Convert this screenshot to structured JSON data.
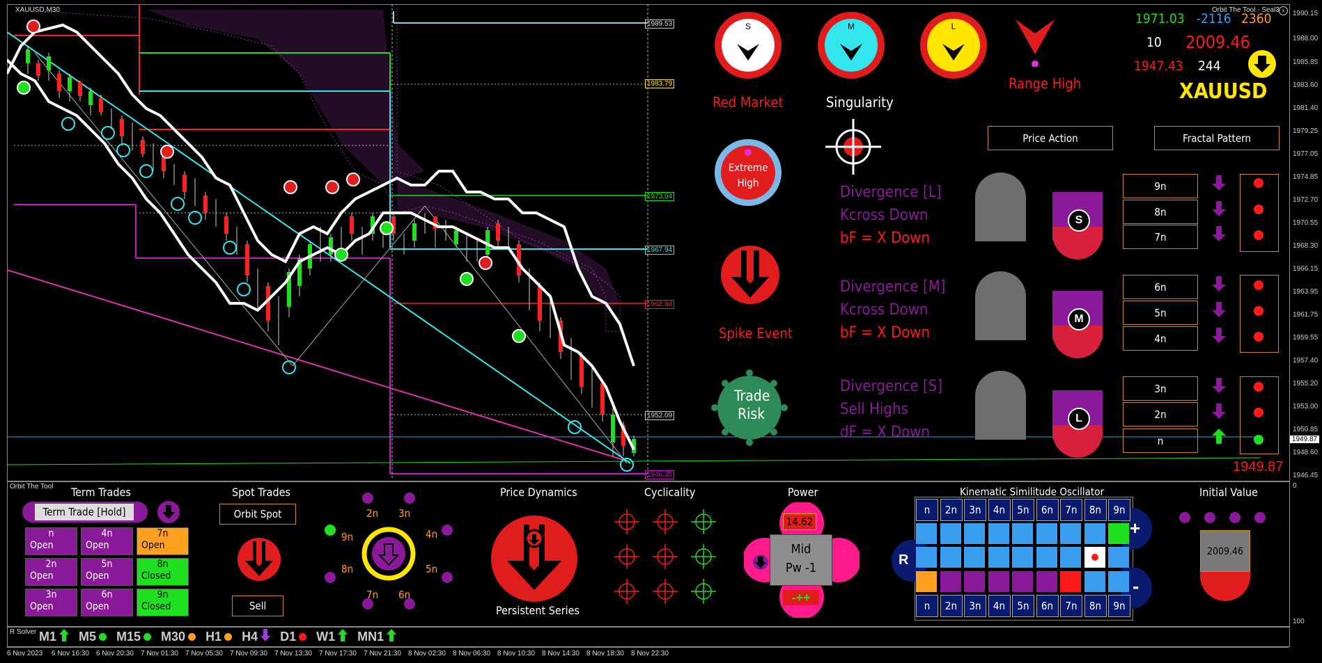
{
  "window": {
    "symbol_title": "XAUUSD,M30",
    "top_right_label": "Orbit The Tool - Seal3"
  },
  "price_axis": {
    "labels": [
      "1990.15",
      "1988.00",
      "1985.85",
      "1983.60",
      "1981.40",
      "1979.25",
      "1977.05",
      "1974.85",
      "1972.70",
      "1970.55",
      "1968.30",
      "1966.15",
      "1963.95",
      "1961.75",
      "1959.55",
      "1957.40",
      "1955.20",
      "1953.00",
      "1950.85",
      "1949.87",
      "1948.60",
      "1946.45"
    ],
    "current_price": "1949.87",
    "sub_labels": [
      "0",
      "100"
    ]
  },
  "price_tags": [
    "1989.53",
    "1983.79",
    "1973.04",
    "1967.94",
    "1962.84",
    "1952.09",
    "1946.35"
  ],
  "bottom_price_big": "1949.87",
  "time_axis": [
    "6 Nov 2023",
    "6 Nov 16:30",
    "6 Nov 20:30",
    "7 Nov 01:30",
    "7 Nov 05:30",
    "7 Nov 09:30",
    "7 Nov 13:30",
    "7 Nov 17:30",
    "7 Nov 21:30",
    "8 Nov 02:30",
    "8 Nov 06:30",
    "8 Nov 10:30",
    "8 Nov 14:30",
    "8 Nov 18:30",
    "8 Nov 22:30"
  ],
  "dashboard": {
    "dial_s": "S",
    "dial_m": "M",
    "dial_l": "L",
    "red_market": "Red Market",
    "singularity": "Singularity",
    "range_high": "Range High",
    "extreme_high_1": "Extreme",
    "extreme_high_2": "High",
    "spike_event": "Spike Event",
    "trade_risk_1": "Trade",
    "trade_risk_2": "Risk",
    "stats": {
      "green": "1971.03",
      "blue": "-2116",
      "orange": "2360",
      "white_count": "10",
      "red_big": "2009.46",
      "red_small": "1947.43",
      "white_244": "244",
      "symbol": "XAUUSD"
    },
    "price_action_btn": "Price Action",
    "fractal_pattern_btn": "Fractal Pattern",
    "div_groups": [
      {
        "line1": "Divergence [L]",
        "line2": "Kcross Down",
        "line3": "bF = X Down",
        "badge": "S"
      },
      {
        "line1": "Divergence [M]",
        "line2": "Kcross Down",
        "line3": "bF = X Down",
        "badge": "M"
      },
      {
        "line1": "Divergence [S]",
        "line2": "Sell Highs",
        "line3": "dF = X Down",
        "badge": "L"
      }
    ],
    "ladder": [
      "9n",
      "8n",
      "7n",
      "6n",
      "5n",
      "4n",
      "3n",
      "2n",
      "n"
    ]
  },
  "bottom_panel": {
    "title": "Orbit The Tool",
    "term_trades": "Term Trades",
    "term_trade_hold": "Term Trade [Hold]",
    "term_cells": [
      {
        "a": "n",
        "b": "Open"
      },
      {
        "a": "4n",
        "b": "Open"
      },
      {
        "a": "7n",
        "b": "Open"
      },
      {
        "a": "2n",
        "b": "Open"
      },
      {
        "a": "5n",
        "b": "Open"
      },
      {
        "a": "8n",
        "b": "Closed"
      },
      {
        "a": "3n",
        "b": "Open"
      },
      {
        "a": "6n",
        "b": "Open"
      },
      {
        "a": "9n",
        "b": "Closed"
      }
    ],
    "spot_trades": "Spot Trades",
    "orbit_spot": "Orbit Spot",
    "sell": "Sell",
    "orbit_labels": [
      "2n",
      "3n",
      "4n",
      "5n",
      "6n",
      "7n",
      "8n",
      "9n"
    ],
    "price_dynamics": "Price Dynamics",
    "persistent_series": "Persistent Series",
    "cyclicality": "Cyclicality",
    "power": "Power",
    "power_value": "14.62",
    "power_mid": "Mid",
    "power_pw": "Pw -1",
    "power_signs": "-++",
    "kso_title": "Kinematic Similitude Oscillator",
    "kso_headers": [
      "n",
      "2n",
      "3n",
      "4n",
      "5n",
      "6n",
      "7n",
      "8n",
      "9n"
    ],
    "kso_r": "R",
    "kso_plus": "+",
    "kso_minus": "-",
    "initial_value": "Initial Value",
    "initial_value_num": "2009.46"
  },
  "solver": {
    "label": "R Solver",
    "timeframes": [
      {
        "tf": "M1",
        "sig": "up"
      },
      {
        "tf": "M5",
        "sig": "dot-green"
      },
      {
        "tf": "M15",
        "sig": "dot-green"
      },
      {
        "tf": "M30",
        "sig": "dot-orange"
      },
      {
        "tf": "H1",
        "sig": "dot-orange"
      },
      {
        "tf": "H4",
        "sig": "down"
      },
      {
        "tf": "D1",
        "sig": "dot-red"
      },
      {
        "tf": "W1",
        "sig": "up"
      },
      {
        "tf": "MN1",
        "sig": "up"
      }
    ]
  },
  "colors": {
    "red": "#ff1a1a",
    "cyan": "#33e6ee",
    "yellow": "#ffe600",
    "purple": "#8b1a9b",
    "orange": "#d58a1a",
    "green": "#1ee01e"
  }
}
